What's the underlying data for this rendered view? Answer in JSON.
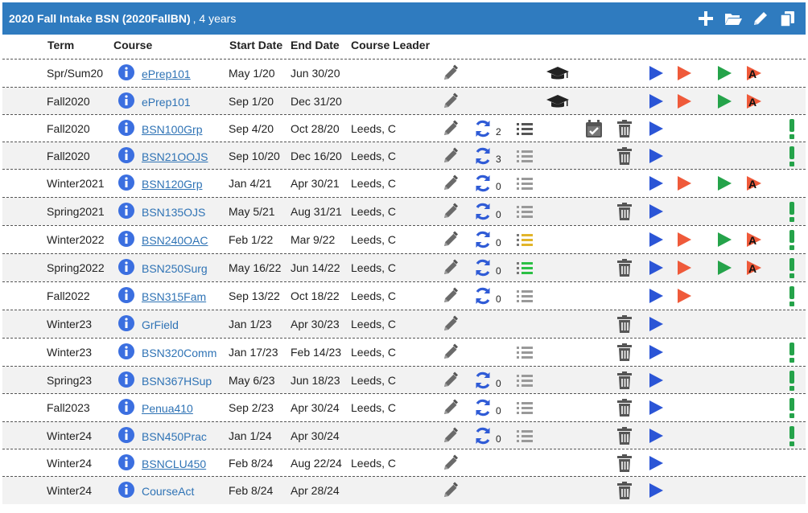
{
  "header": {
    "title": "2020 Fall Intake BSN (2020FallBN)",
    "subtitle": ", 4 years",
    "tools": [
      "plus-icon",
      "folder-open-icon",
      "pencil-icon",
      "copy-icon"
    ]
  },
  "columns": {
    "term": "Term",
    "course": "Course",
    "start": "Start Date",
    "end": "End Date",
    "leader": "Course Leader"
  },
  "colors": {
    "header_bg": "#2f7bbf",
    "link": "#2f73b5",
    "info": "#3b6fe0",
    "play_blue": "#2b55d6",
    "play_orange": "#ef5a3a",
    "play_green": "#25a34a",
    "exclaim": "#25a34a",
    "sync": "#2f5bd6"
  },
  "rows": [
    {
      "term": "Spr/Sum20",
      "course": "ePrep101",
      "underline": true,
      "start": "May 1/20",
      "end": "Jun 30/20",
      "leader": "",
      "sync": null,
      "list": null,
      "cap": true,
      "cal": false,
      "trash": false,
      "blue": true,
      "orange": true,
      "green": true,
      "a": true,
      "exclaim": false
    },
    {
      "term": "Fall2020",
      "course": "ePrep101",
      "underline": false,
      "start": "Sep 1/20",
      "end": "Dec 31/20",
      "leader": "",
      "sync": null,
      "list": null,
      "cap": true,
      "cal": false,
      "trash": false,
      "blue": true,
      "orange": true,
      "green": true,
      "a": true,
      "exclaim": false
    },
    {
      "term": "Fall2020",
      "course": "BSN100Grp",
      "underline": true,
      "start": "Sep 4/20",
      "end": "Oct 28/20",
      "leader": "Leeds, C",
      "sync": "2",
      "list": "dark",
      "cap": false,
      "cal": true,
      "trash": true,
      "blue": true,
      "orange": false,
      "green": false,
      "a": false,
      "exclaim": true
    },
    {
      "term": "Fall2020",
      "course": "BSN21OOJS",
      "underline": true,
      "start": "Sep 10/20",
      "end": "Dec 16/20",
      "leader": "Leeds, C",
      "sync": "3",
      "list": "gray",
      "cap": false,
      "cal": false,
      "trash": true,
      "blue": true,
      "orange": false,
      "green": false,
      "a": false,
      "exclaim": true
    },
    {
      "term": "Winter2021",
      "course": "BSN120Grp",
      "underline": true,
      "start": "Jan 4/21",
      "end": "Apr 30/21",
      "leader": "Leeds, C",
      "sync": "0",
      "list": "gray",
      "cap": false,
      "cal": false,
      "trash": false,
      "blue": true,
      "orange": true,
      "green": true,
      "a": true,
      "exclaim": false
    },
    {
      "term": "Spring2021",
      "course": "BSN135OJS",
      "underline": false,
      "start": "May 5/21",
      "end": "Aug 31/21",
      "leader": "Leeds, C",
      "sync": "0",
      "list": "gray",
      "cap": false,
      "cal": false,
      "trash": true,
      "blue": true,
      "orange": false,
      "green": false,
      "a": false,
      "exclaim": true
    },
    {
      "term": "Winter2022",
      "course": "BSN240OAC",
      "underline": true,
      "start": "Feb 1/22",
      "end": "Mar 9/22",
      "leader": "Leeds, C",
      "sync": "0",
      "list": "yellow",
      "cap": false,
      "cal": false,
      "trash": false,
      "blue": true,
      "orange": true,
      "green": true,
      "a": true,
      "exclaim": true
    },
    {
      "term": "Spring2022",
      "course": "BSN250Surg",
      "underline": false,
      "start": "May 16/22",
      "end": "Jun 14/22",
      "leader": "Leeds, C",
      "sync": "0",
      "list": "green",
      "cap": false,
      "cal": false,
      "trash": true,
      "blue": true,
      "orange": true,
      "green": true,
      "a": true,
      "exclaim": true
    },
    {
      "term": "Fall2022",
      "course": "BSN315Fam",
      "underline": true,
      "start": "Sep 13/22",
      "end": "Oct 18/22",
      "leader": "Leeds, C",
      "sync": "0",
      "list": "gray",
      "cap": false,
      "cal": false,
      "trash": false,
      "blue": true,
      "orange": true,
      "green": false,
      "a": false,
      "exclaim": true
    },
    {
      "term": "Winter23",
      "course": "GrField",
      "underline": false,
      "start": "Jan 1/23",
      "end": "Apr 30/23",
      "leader": "Leeds, C",
      "sync": null,
      "list": null,
      "cap": false,
      "cal": false,
      "trash": true,
      "blue": true,
      "orange": false,
      "green": false,
      "a": false,
      "exclaim": false
    },
    {
      "term": "Winter23",
      "course": "BSN320Comm",
      "underline": false,
      "start": "Jan 17/23",
      "end": "Feb 14/23",
      "leader": "Leeds, C",
      "sync": null,
      "list": "gray",
      "cap": false,
      "cal": false,
      "trash": true,
      "blue": true,
      "orange": false,
      "green": false,
      "a": false,
      "exclaim": true
    },
    {
      "term": "Spring23",
      "course": "BSN367HSup",
      "underline": false,
      "start": "May 6/23",
      "end": "Jun 18/23",
      "leader": "Leeds, C",
      "sync": "0",
      "list": "gray",
      "cap": false,
      "cal": false,
      "trash": true,
      "blue": true,
      "orange": false,
      "green": false,
      "a": false,
      "exclaim": true
    },
    {
      "term": "Fall2023",
      "course": "Penua410",
      "underline": true,
      "start": "Sep 2/23",
      "end": "Apr 30/24",
      "leader": "Leeds, C",
      "sync": "0",
      "list": "gray",
      "cap": false,
      "cal": false,
      "trash": true,
      "blue": true,
      "orange": false,
      "green": false,
      "a": false,
      "exclaim": true
    },
    {
      "term": "Winter24",
      "course": "BSN450Prac",
      "underline": false,
      "start": "Jan 1/24",
      "end": "Apr 30/24",
      "leader": "",
      "sync": "0",
      "list": "gray",
      "cap": false,
      "cal": false,
      "trash": true,
      "blue": true,
      "orange": false,
      "green": false,
      "a": false,
      "exclaim": true
    },
    {
      "term": "Winter24",
      "course": "BSNCLU450",
      "underline": true,
      "start": "Feb 8/24",
      "end": "Aug 22/24",
      "leader": "Leeds, C",
      "sync": null,
      "list": null,
      "cap": false,
      "cal": false,
      "trash": true,
      "blue": true,
      "orange": false,
      "green": false,
      "a": false,
      "exclaim": false
    },
    {
      "term": "Winter24",
      "course": "CourseAct",
      "underline": false,
      "start": "Feb 8/24",
      "end": "Apr 28/24",
      "leader": "",
      "sync": null,
      "list": null,
      "cap": false,
      "cal": false,
      "trash": true,
      "blue": true,
      "orange": false,
      "green": false,
      "a": false,
      "exclaim": false
    }
  ]
}
